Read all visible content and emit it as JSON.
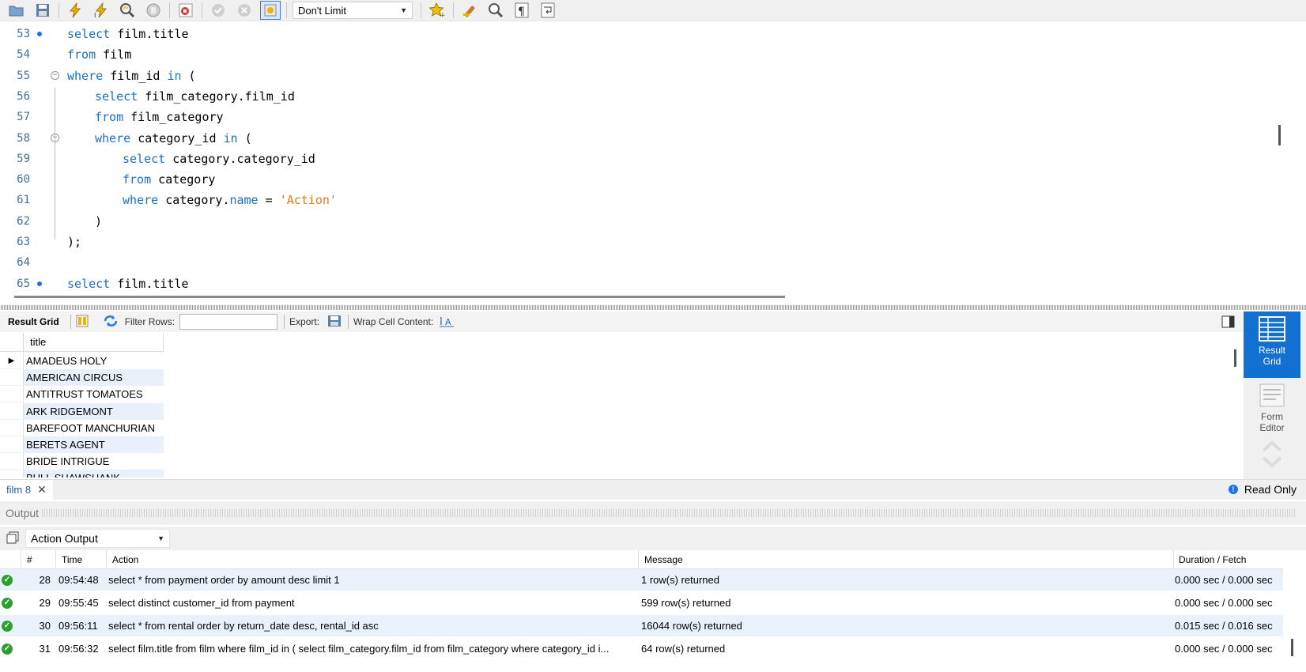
{
  "toolbar": {
    "icons": [
      "open-folder-icon",
      "save-icon",
      "execute-icon",
      "execute-current-icon",
      "explain-icon",
      "stop-icon",
      "toggle-error-icon",
      "commit-icon",
      "rollback-icon",
      "autocommit-icon",
      "bookmark-icon",
      "beautify-icon",
      "find-icon",
      "invisible-chars-icon",
      "wrap-icon"
    ],
    "limit_value": "Don't Limit"
  },
  "editor": {
    "lines": [
      {
        "num": "53",
        "marker": true,
        "fold": false,
        "indent": 0,
        "tokens": [
          [
            "kw",
            "select"
          ],
          [
            "",
            "film.title"
          ]
        ]
      },
      {
        "num": "54",
        "marker": false,
        "fold": false,
        "indent": 0,
        "tokens": [
          [
            "kw",
            "from"
          ],
          [
            "",
            "film"
          ]
        ]
      },
      {
        "num": "55",
        "marker": false,
        "fold": true,
        "indent": 0,
        "tokens": [
          [
            "kw",
            "where"
          ],
          [
            "",
            "film_id"
          ],
          [
            "kw",
            "in"
          ],
          [
            "",
            "("
          ]
        ]
      },
      {
        "num": "56",
        "marker": false,
        "fold": false,
        "indent": 1,
        "tokens": [
          [
            "kw",
            "select"
          ],
          [
            "",
            "film_category.film_id"
          ]
        ]
      },
      {
        "num": "57",
        "marker": false,
        "fold": false,
        "indent": 1,
        "tokens": [
          [
            "kw",
            "from"
          ],
          [
            "",
            "film_category"
          ]
        ]
      },
      {
        "num": "58",
        "marker": false,
        "fold": true,
        "indent": 1,
        "tokens": [
          [
            "kw",
            "where"
          ],
          [
            "",
            "category_id"
          ],
          [
            "kw",
            "in"
          ],
          [
            "",
            "("
          ]
        ]
      },
      {
        "num": "59",
        "marker": false,
        "fold": false,
        "indent": 2,
        "tokens": [
          [
            "kw",
            "select"
          ],
          [
            "",
            "category.category_id"
          ]
        ]
      },
      {
        "num": "60",
        "marker": false,
        "fold": false,
        "indent": 2,
        "tokens": [
          [
            "kw",
            "from"
          ],
          [
            "",
            "category"
          ]
        ]
      },
      {
        "num": "61",
        "marker": false,
        "fold": false,
        "indent": 2,
        "tokens": [
          [
            "kw",
            "where"
          ],
          [
            "",
            "category."
          ],
          [
            "kw",
            "name"
          ],
          [
            "",
            "="
          ],
          [
            "str",
            "'Action'"
          ]
        ]
      },
      {
        "num": "62",
        "marker": false,
        "fold": false,
        "indent": 1,
        "tokens": [
          [
            "",
            ")"
          ]
        ]
      },
      {
        "num": "63",
        "marker": false,
        "fold": false,
        "indent": 0,
        "tokens": [
          [
            "",
            ");"
          ]
        ]
      },
      {
        "num": "64",
        "marker": false,
        "fold": false,
        "indent": 0,
        "tokens": []
      },
      {
        "num": "65",
        "marker": true,
        "fold": false,
        "indent": 0,
        "tokens": [
          [
            "kw",
            "select"
          ],
          [
            "",
            "film.title"
          ]
        ]
      }
    ]
  },
  "result_toolbar": {
    "result_grid_label": "Result Grid",
    "filter_label": "Filter Rows:",
    "export_label": "Export:",
    "wrap_label": "Wrap Cell Content:"
  },
  "result_grid": {
    "column": "title",
    "rows": [
      "AMADEUS HOLY",
      "AMERICAN CIRCUS",
      "ANTITRUST TOMATOES",
      "ARK RIDGEMONT",
      "BAREFOOT MANCHURIAN",
      "BERETS AGENT",
      "BRIDE INTRIGUE",
      "BULL SHAWSHANK"
    ]
  },
  "side_panel": {
    "result_grid_label": "Result Grid",
    "form_editor_label": "Form Editor"
  },
  "tabs": {
    "active": "film 8",
    "read_only": "Read Only"
  },
  "output": {
    "title": "Output",
    "select_value": "Action Output",
    "columns": [
      "#",
      "Time",
      "Action",
      "Message",
      "Duration / Fetch"
    ],
    "rows": [
      {
        "n": "28",
        "time": "09:54:48",
        "action": "select * from payment order by amount desc limit 1",
        "message": "1 row(s) returned",
        "duration": "0.000 sec / 0.000 sec"
      },
      {
        "n": "29",
        "time": "09:55:45",
        "action": "select distinct customer_id from payment",
        "message": "599 row(s) returned",
        "duration": "0.000 sec / 0.000 sec"
      },
      {
        "n": "30",
        "time": "09:56:11",
        "action": "select * from rental order by return_date desc, rental_id asc",
        "message": "16044 row(s) returned",
        "duration": "0.015 sec / 0.016 sec"
      },
      {
        "n": "31",
        "time": "09:56:32",
        "action": "select film.title from film where film_id in ( select film_category.film_id     from film_category     where category_id i...",
        "message": "64 row(s) returned",
        "duration": "0.000 sec / 0.000 sec"
      }
    ]
  }
}
